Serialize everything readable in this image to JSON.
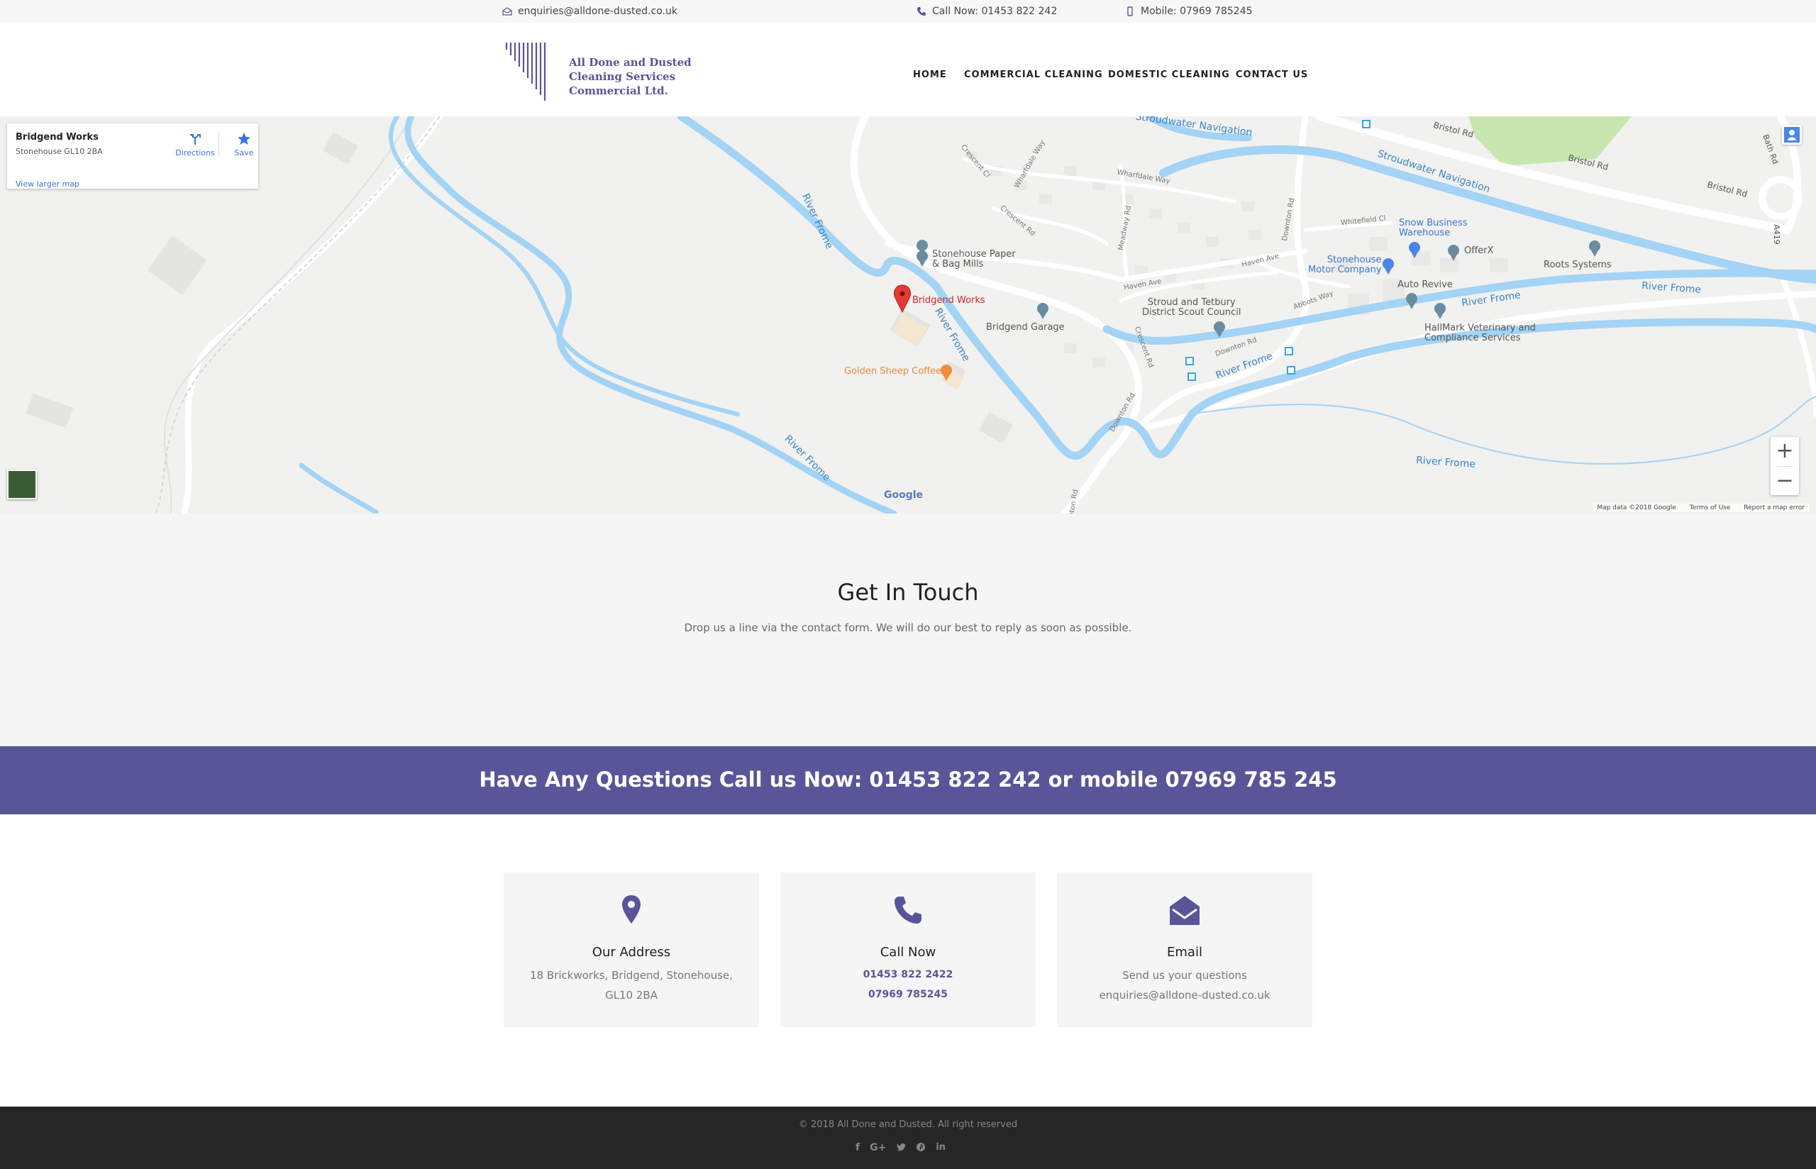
{
  "topbar": {
    "email": "enquiries@alldone-dusted.co.uk",
    "call": "Call Now: 01453 822 242",
    "mobile": "Mobile: 07969 785245"
  },
  "logo": {
    "line1": "All Done and Dusted",
    "line2": "Cleaning Services",
    "line3": "Commercial Ltd."
  },
  "nav": {
    "home": "HOME",
    "commercial": "COMMERCIAL CLEANING",
    "domestic": "DOMESTIC CLEANING",
    "contact": "CONTACT US"
  },
  "map": {
    "place_title": "Bridgend Works",
    "place_address": "Stonehouse GL10 2BA",
    "view_larger": "View larger map",
    "directions": "Directions",
    "save": "Save",
    "marker_label": "Bridgend Works",
    "google": "Google",
    "attribution": {
      "data": "Map data ©2018 Google",
      "terms": "Terms of Use",
      "report": "Report a map error"
    },
    "labels": {
      "stroudwater_nav_1": "Stroudwater Navigation",
      "stroudwater_nav_2": "Stroudwater Navigation",
      "bristol_rd_1": "Bristol Rd",
      "bristol_rd_2": "Bristol Rd",
      "bristol_rd_3": "Bristol Rd",
      "bath_rd": "Bath Rd",
      "a419": "A419",
      "river_frome_1": "River Frome",
      "river_frome_2": "River Frome",
      "river_frome_3": "River Frome",
      "river_frome_4": "River Frome",
      "river_frome_5": "River Frome",
      "river_frome_6": "River Frome",
      "river_frome_7": "River Frome",
      "stonehouse_paper_1": "Stonehouse Paper",
      "stonehouse_paper_2": "& Bag Mills",
      "bridgend_garage": "Bridgend Garage",
      "golden_sheep": "Golden Sheep Coffee",
      "stroud_scout_1": "Stroud and Tetbury",
      "stroud_scout_2": "District Scout Council",
      "snow_business_1": "Snow Business",
      "snow_business_2": "Warehouse",
      "offerx": "OfferX",
      "roots_systems": "Roots Systems",
      "stonehouse_motor_1": "Stonehouse",
      "stonehouse_motor_2": "Motor Company",
      "auto_revive": "Auto Revive",
      "hallmark_1": "HallMark Veterinary and",
      "hallmark_2": "Compliance Services",
      "haven_ave_1": "Haven Ave",
      "haven_ave_2": "Haven Ave",
      "whitefield_cl": "Whitefield Cl",
      "abbots_way": "Abbots Way",
      "downton_rd_1": "Downton Rd",
      "downton_rd_2": "Downton Rd",
      "downton_rd_3": "Downton Rd",
      "crescent_rd_1": "Crescent Rd",
      "crescent_rd_2": "Crescent Rd",
      "crescent_cl": "Crescent Cl",
      "wharfdale_way_1": "Wharfdale Way",
      "wharfdale_way_2": "Wharfdale Way",
      "meadway_rd": "Meadway Rd",
      "edge_road": "nton Rd"
    }
  },
  "touch": {
    "title": "Get In Touch",
    "subtitle": "Drop us a line via the contact form. We will do our best to reply as soon as possible."
  },
  "band": {
    "text": "Have Any Questions Call us Now: 01453 822 242 or mobile 07969 785 245"
  },
  "cards": {
    "address": {
      "title": "Our Address",
      "line1": "18 Brickworks, Bridgend, Stonehouse,",
      "line2": "GL10 2BA"
    },
    "call": {
      "title": "Call Now",
      "line1": "01453 822 2422",
      "line2": "07969 785245"
    },
    "email": {
      "title": "Email",
      "line1": "Send us your questions",
      "line2": "enquiries@alldone-dusted.co.uk"
    }
  },
  "footer": {
    "copyright": "© 2018 All Done and Dusted. All right reserved",
    "social_icons": [
      "facebook-icon",
      "google-plus-icon",
      "twitter-icon",
      "pinterest-icon",
      "linkedin-icon"
    ]
  },
  "colors": {
    "brand": "#595598",
    "map_water": "#a3d3f5",
    "map_label_water": "#3a84c6",
    "marker": "#e53935"
  }
}
